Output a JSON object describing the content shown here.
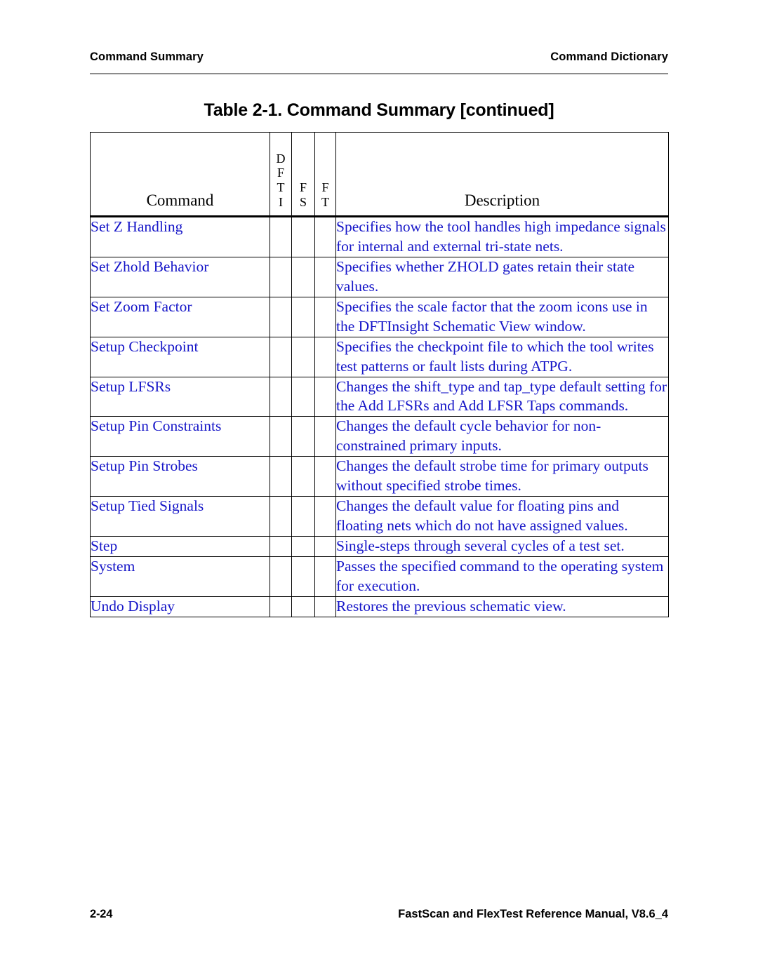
{
  "running_header": {
    "left": "Command Summary",
    "right": "Command Dictionary"
  },
  "table_title": "Table 2-1. Command Summary [continued]",
  "table": {
    "columns": {
      "command": "Command",
      "dfti": [
        "D",
        "F",
        "T",
        "I"
      ],
      "fs": [
        "F",
        "S"
      ],
      "ft": [
        "F",
        "T"
      ],
      "description": "Description"
    },
    "rows": [
      {
        "command": "Set Z Handling",
        "dfti": "",
        "fs": "",
        "ft": "",
        "description": "Specifies how the tool handles high impedance signals for internal and external tri-state nets."
      },
      {
        "command": "Set Zhold Behavior",
        "dfti": "",
        "fs": "",
        "ft": "",
        "description": "Specifies whether ZHOLD gates retain their state values."
      },
      {
        "command": "Set Zoom Factor",
        "dfti": "",
        "fs": "",
        "ft": "",
        "description": "Specifies the scale factor that the zoom icons use in the DFTInsight Schematic View window."
      },
      {
        "command": "Setup Checkpoint",
        "dfti": "",
        "fs": "",
        "ft": "",
        "description": "Specifies the checkpoint file to which the tool writes test patterns or fault lists during ATPG."
      },
      {
        "command": "Setup LFSRs",
        "dfti": "",
        "fs": "",
        "ft": "",
        "description": "Changes the shift_type and tap_type default setting for the Add LFSRs and Add LFSR Taps commands."
      },
      {
        "command": "Setup Pin Constraints",
        "dfti": "",
        "fs": "",
        "ft": "",
        "description": "Changes the default cycle behavior for non-constrained primary inputs."
      },
      {
        "command": "Setup Pin Strobes",
        "dfti": "",
        "fs": "",
        "ft": "",
        "description": "Changes the default strobe time for primary outputs without specified strobe times."
      },
      {
        "command": "Setup Tied Signals",
        "dfti": "",
        "fs": "",
        "ft": "",
        "description": "Changes the default value for floating pins and floating nets which do not have assigned values."
      },
      {
        "command": "Step",
        "dfti": "",
        "fs": "",
        "ft": "",
        "description": "Single-steps through several cycles of a test set."
      },
      {
        "command": "System",
        "dfti": "",
        "fs": "",
        "ft": "",
        "description": "Passes the specified command to the operating system for execution."
      },
      {
        "command": "Undo Display",
        "dfti": "",
        "fs": "",
        "ft": "",
        "description": "Restores the previous schematic view."
      }
    ]
  },
  "footer": {
    "page_number": "2-24",
    "manual": "FastScan and FlexTest Reference Manual, V8.6_4"
  },
  "colors": {
    "link_blue": "#1616c8",
    "rule_gray": "#8c8c8c",
    "text_black": "#000000"
  }
}
